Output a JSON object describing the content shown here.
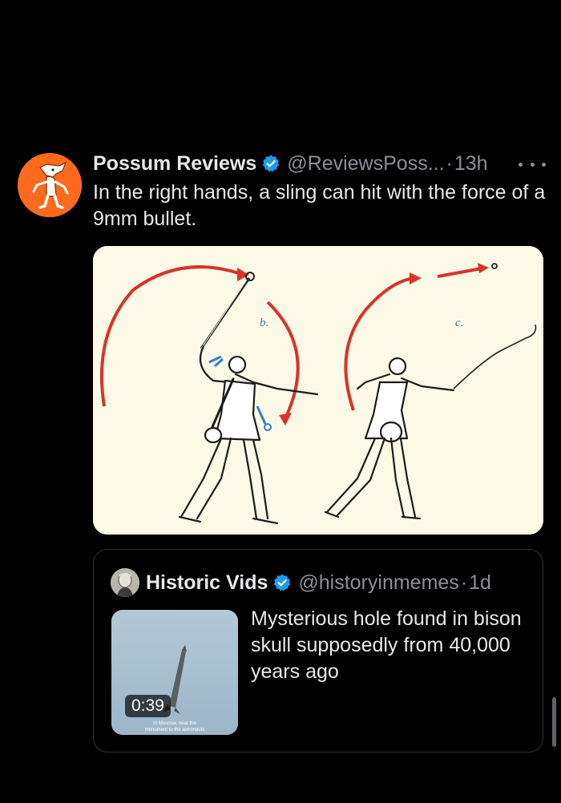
{
  "post": {
    "author_name": "Possum Reviews",
    "handle": "@ReviewsPoss...",
    "separator": "·",
    "time": "13h",
    "text": "In the right hands, a sling can hit with the force of a 9mm bullet.",
    "avatar_icon": "possum-avatar",
    "avatar_color": "#ff6a1c",
    "verified_color": "#1d9bf0"
  },
  "media": {
    "label_b": "b.",
    "label_c": "c.",
    "arrow_color": "#d7342a",
    "background": "#fcfae7"
  },
  "quote": {
    "author_name": "Historic Vids",
    "handle": "@historyinmemes",
    "separator": "·",
    "time": "1d",
    "text": "Mysterious hole found in bison skull supposedly from 40,000 years ago",
    "duration": "0:39",
    "thumb_caption_line1": "In Moscow, near the",
    "thumb_caption_line2": "monument to the astronauts"
  }
}
